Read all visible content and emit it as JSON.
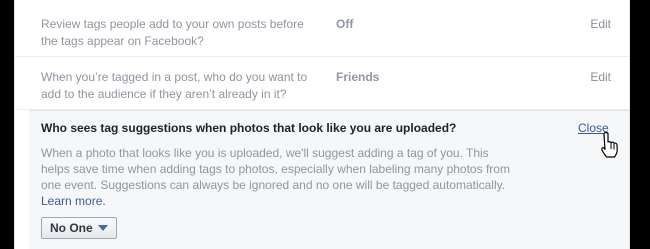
{
  "settings": {
    "rows": [
      {
        "question": "Review tags people add to your own posts before the tags appear on Facebook?",
        "value": "Off",
        "edit_label": "Edit"
      },
      {
        "question": "When you’re tagged in a post, who do you want to add to the audience if they aren’t already in it?",
        "value": "Friends",
        "edit_label": "Edit"
      }
    ],
    "expanded": {
      "title": "Who sees tag suggestions when photos that look like you are uploaded?",
      "close_label": "Close",
      "description": "When a photo that looks like you is uploaded, we'll suggest adding a tag of you. This helps save time when adding tags to photos, especially when labeling many photos from one event. Suggestions can always be ignored and no one will be tagged automatically.",
      "learn_more": "Learn more.",
      "dropdown_value": "No One"
    }
  },
  "icons": {
    "cursor": "hand-pointer-icon",
    "dropdown_caret": "caret-down-icon"
  },
  "colors": {
    "link": "#3b5998",
    "muted_text": "#8f959f",
    "expanded_bg": "#f6f7f9"
  }
}
